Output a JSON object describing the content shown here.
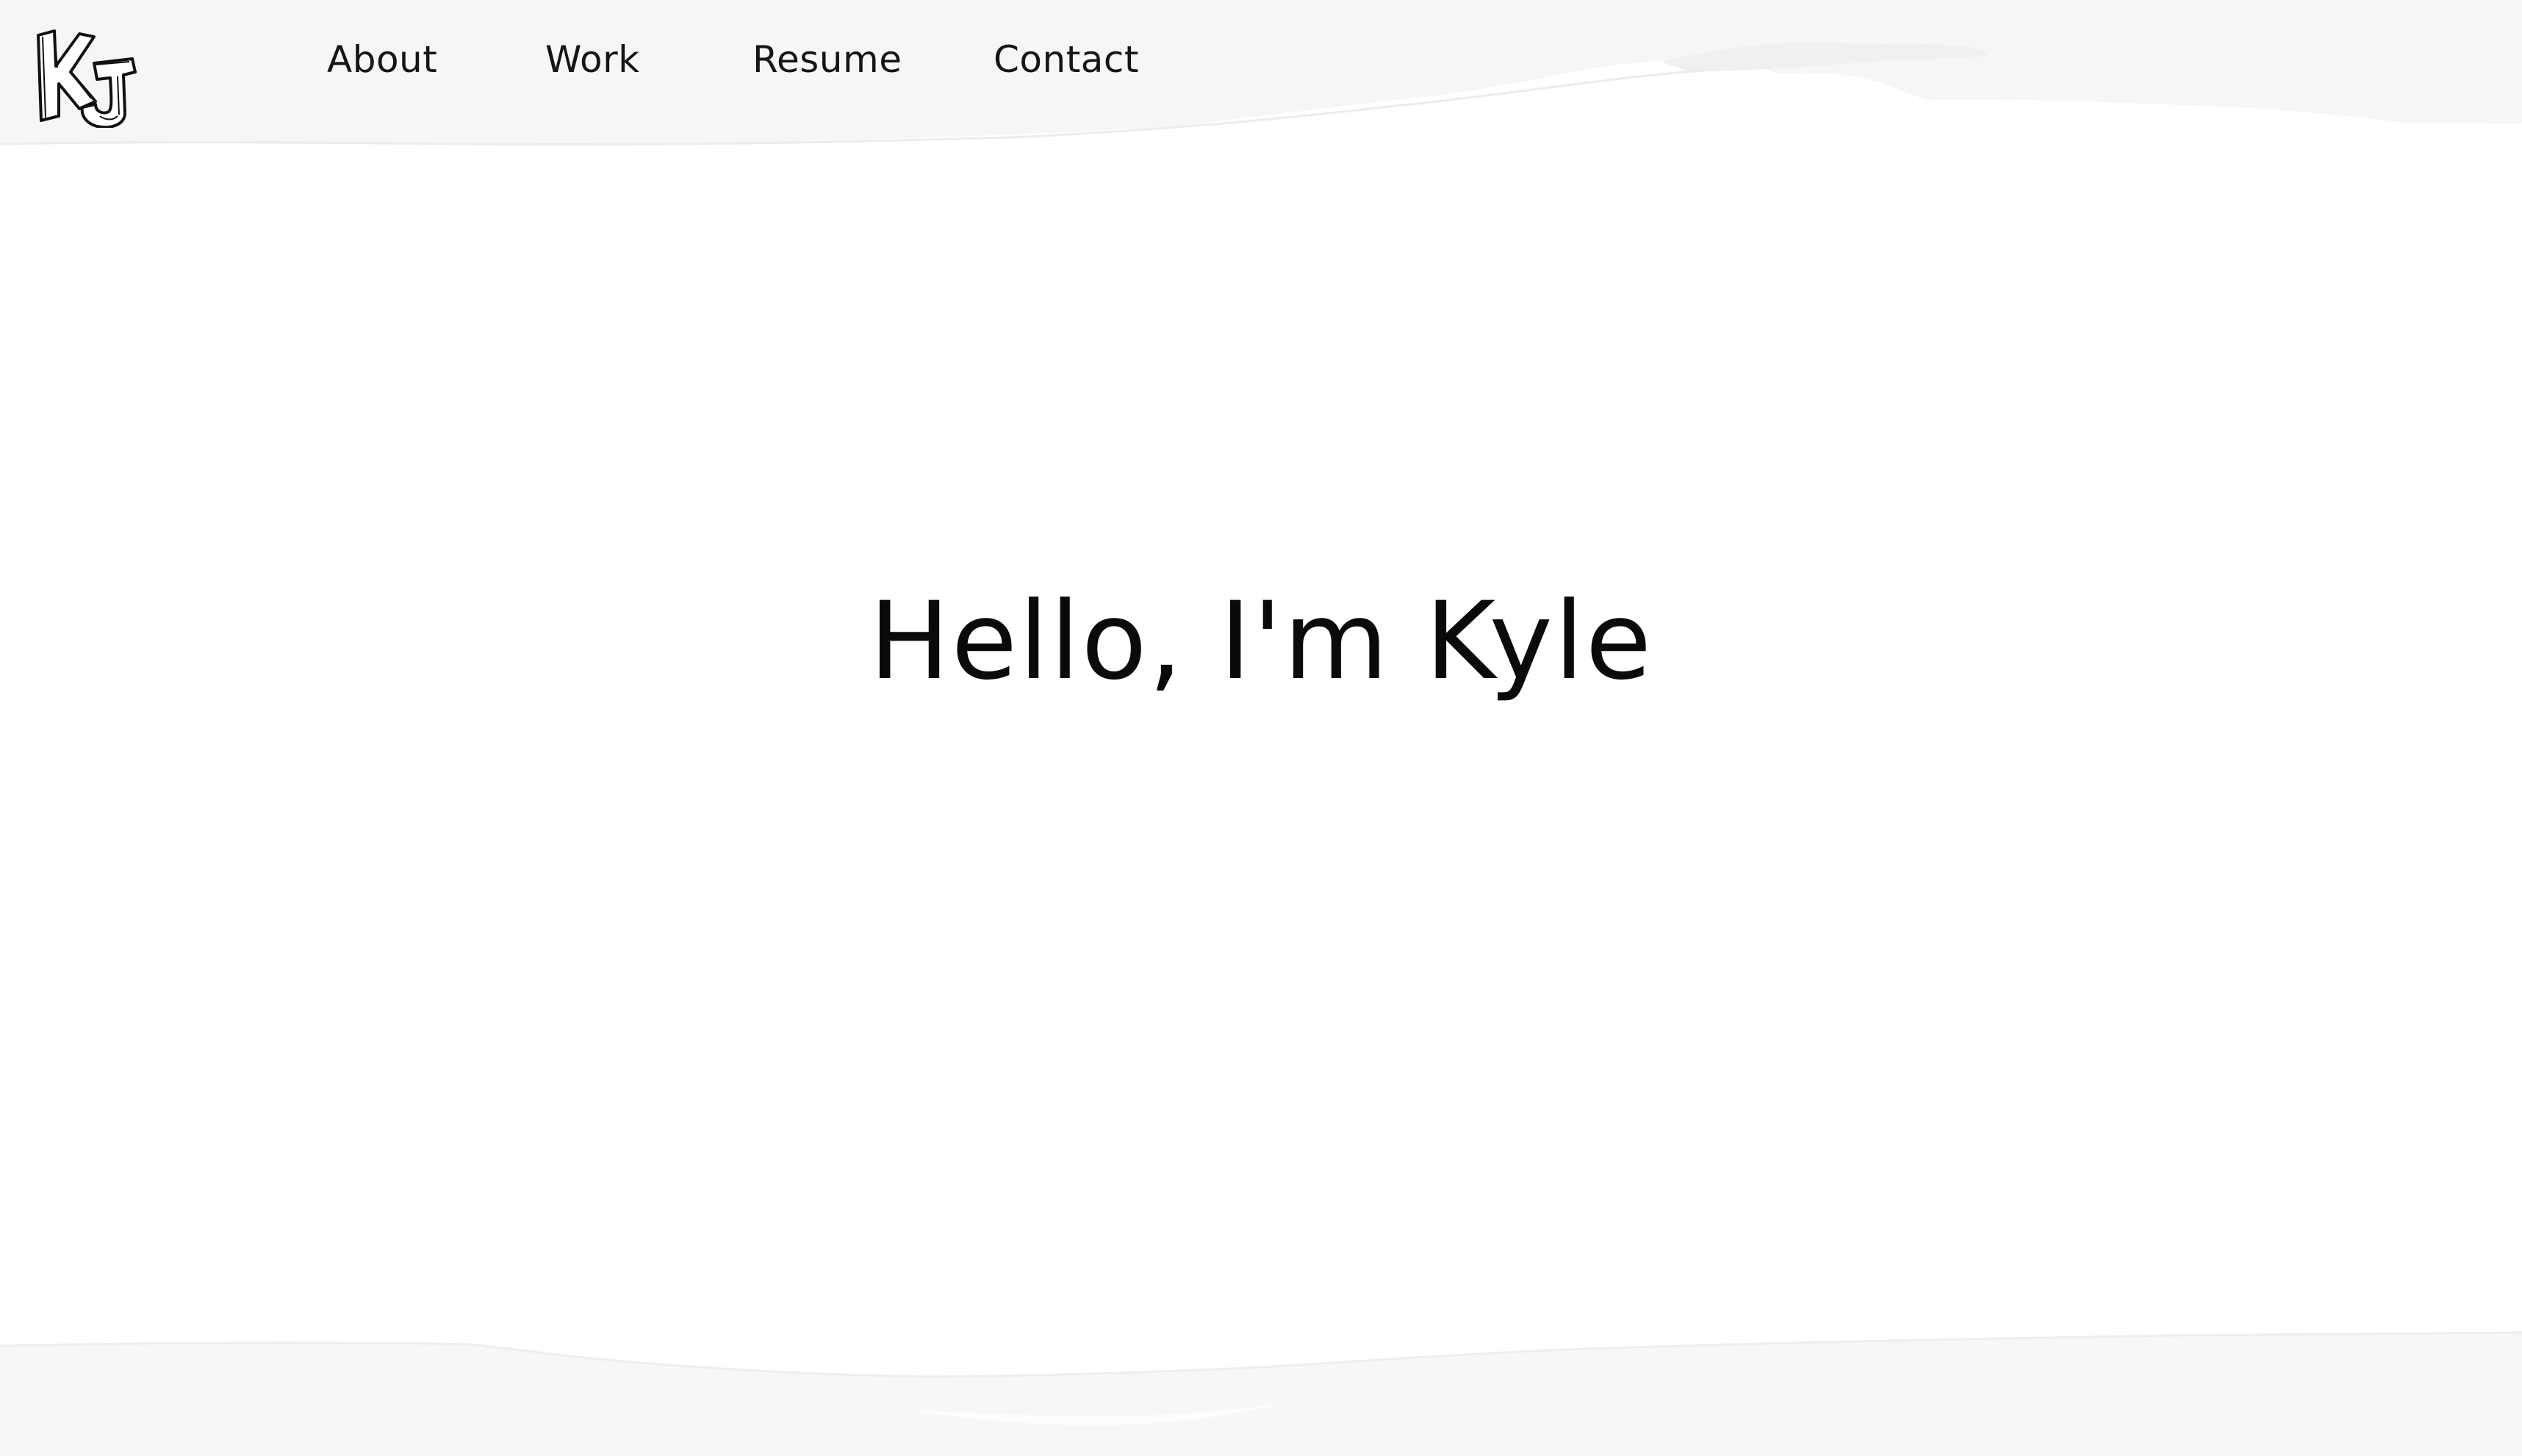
{
  "colors": {
    "page_background": "#ffffff",
    "paper_band": "#f7f7f7",
    "text": "#111111"
  },
  "logo": {
    "icon": "kj-monogram-logo"
  },
  "nav": {
    "items": [
      {
        "label": "About"
      },
      {
        "label": "Work"
      },
      {
        "label": "Resume"
      },
      {
        "label": "Contact"
      }
    ]
  },
  "hero": {
    "title": "Hello, I'm Kyle"
  }
}
